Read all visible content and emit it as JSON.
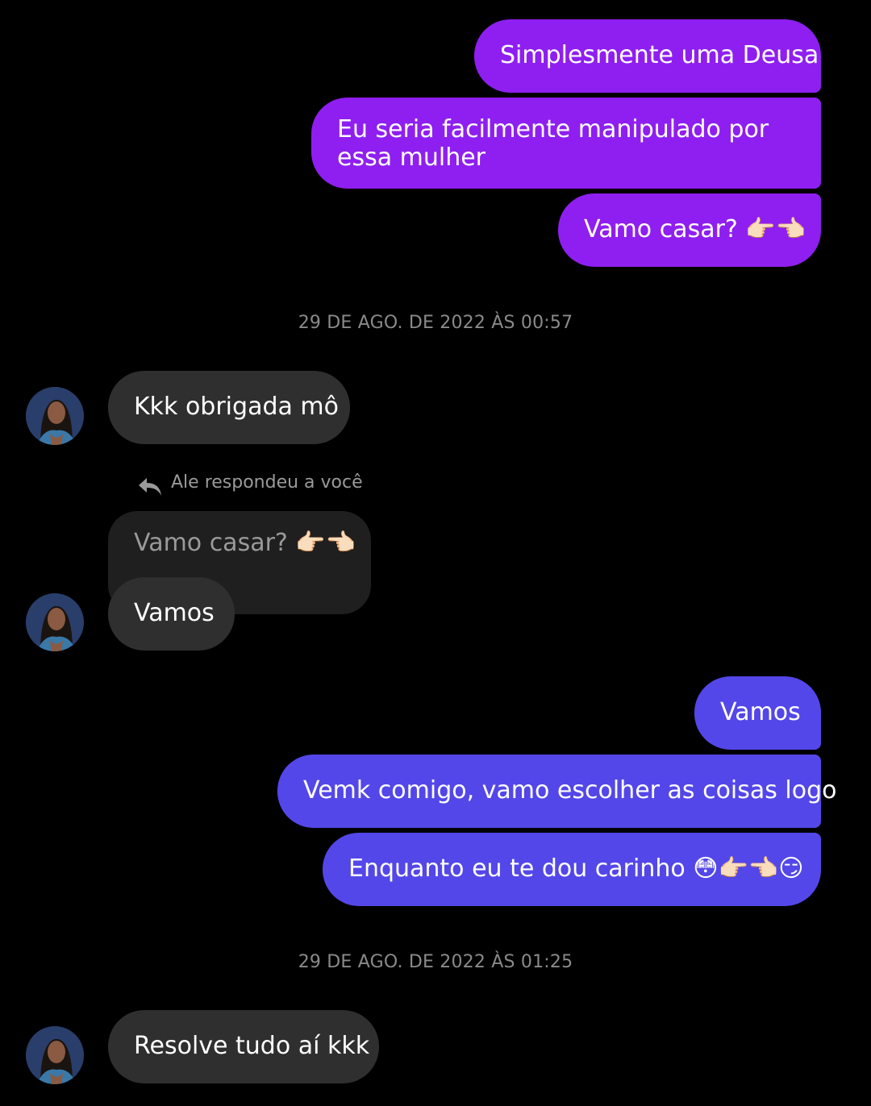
{
  "conversation": {
    "block1": [
      {
        "text": "Simplesmente uma Deusa"
      },
      {
        "text": "Eu seria facilmente manipulado por essa mulher"
      },
      {
        "text": "Vamo casar? 👉🏻👈🏻"
      }
    ],
    "timestamp1": "29 DE AGO. DE 2022 ÀS 00:57",
    "received1": "Kkk obrigada mô",
    "reply": {
      "label": "Ale respondeu a você",
      "quoted": "Vamo casar? 👉🏻👈🏻",
      "text": "Vamos"
    },
    "block2": [
      {
        "text": "Vamos"
      },
      {
        "text": "Vemk comigo, vamo escolher as coisas logo"
      },
      {
        "text": "Enquanto eu te dou carinho 😳👉🏻👈🏻😏"
      }
    ],
    "timestamp2": "29 DE AGO. DE 2022 ÀS 01:25",
    "received2": "Resolve tudo aí kkk"
  },
  "colors": {
    "background": "#000000",
    "sent_purple": "#8f1ff0",
    "sent_blue": "#5347e9",
    "received_bubble": "#2f2f2f",
    "quoted_bubble": "#1f1f1f",
    "timestamp_text": "#8a8a8a"
  },
  "icons": {
    "reply": "reply-arrow-icon",
    "avatar": "contact-avatar"
  }
}
